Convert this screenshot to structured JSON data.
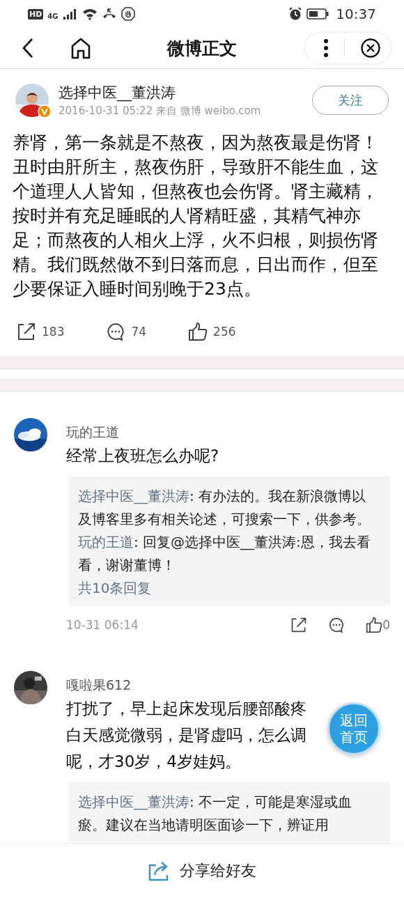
{
  "status_bar": {
    "hd": "HD",
    "network": "4G",
    "time": "10:37"
  },
  "nav": {
    "title": "微博正文"
  },
  "post": {
    "author": "选择中医__董洪涛",
    "verified": true,
    "meta": "2016-10-31 05:22 来自 微博 weibo.com",
    "follow": "关注",
    "text": "养肾，第一条就是不熬夜，因为熬夜最是伤肾！丑时由肝所主，熬夜伤肝，导致肝不能生血，这个道理人人皆知，但熬夜也会伤肾。肾主藏精，按时并有充足睡眠的人肾精旺盛，其精气神亦足；而熬夜的人相火上浮，火不归根，则损伤肾精。我们既然做不到日落而息，日出而作，但至少要保证入睡时间别晚于23点。",
    "actions": [
      {
        "kind": "repost",
        "count": "183"
      },
      {
        "kind": "comment",
        "count": "74"
      },
      {
        "kind": "like",
        "count": "256"
      }
    ]
  },
  "comments": [
    {
      "author": "玩的王道",
      "lines": [
        "经常上夜班怎么办呢?"
      ],
      "replies": [
        {
          "author": "选择中医__董洪涛",
          "text": ": 有办法的。我在新浪微博以及博客里多有相关论述，可搜索一下，供参考。"
        },
        {
          "author": "玩的王道",
          "text": ": 回复@选择中医__董洪涛:恩，我去看看，谢谢董博！"
        }
      ],
      "more": "共10条回复",
      "time": "10-31 06:14",
      "likes": "0"
    },
    {
      "author": "嘎啦果612",
      "lines": [
        "打扰了，早上起床发现后腰部酸疼",
        "白天感觉微弱，是肾虚吗，怎么调",
        "呢，才30岁，4岁娃妈。"
      ],
      "replies": [
        {
          "author": "选择中医__董洪涛",
          "text": ": 不一定，可能是寒湿或血瘀。建议在当地请明医面诊一下，辨证用"
        }
      ]
    }
  ],
  "float_button": "返回首页",
  "bottom_bar": {
    "label": "分享给好友"
  }
}
